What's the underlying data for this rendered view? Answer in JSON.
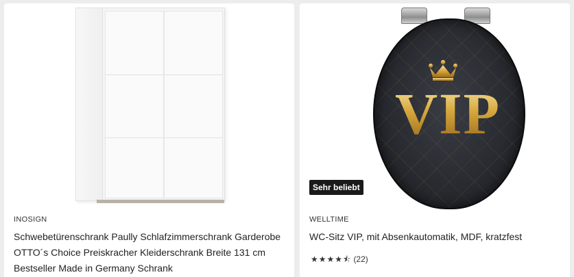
{
  "products": [
    {
      "brand": "INOSIGN",
      "title": "Schwebetürenschrank Paully Schlafzimmerschrank Garderobe OTTO´s Choice Preiskracher Kleiderschrank Breite 131 cm Bestseller Made in Germany Schrank",
      "image": "white-sliding-wardrobe"
    },
    {
      "brand": "WELLTIME",
      "title": "WC-Sitz VIP, mit Absenkautomatik, MDF, kratzfest",
      "badge": "Sehr beliebt",
      "image_text": "VIP",
      "rating": 4.5,
      "rating_count": "(22)",
      "image": "black-vip-toilet-seat"
    }
  ]
}
